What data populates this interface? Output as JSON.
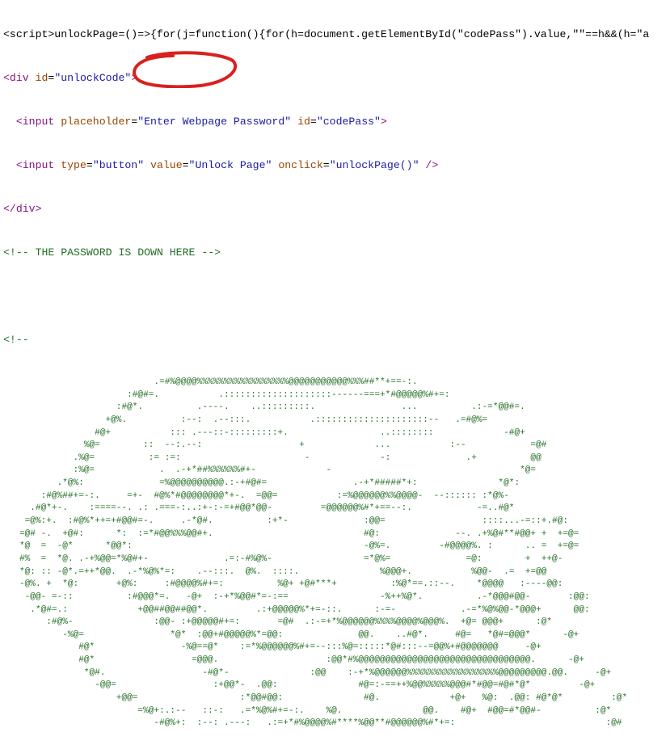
{
  "source": {
    "script_line": "<script>unlockPage=()=>{for(j=function(){for(h=document.getElementById(\"codePass\").value,\"\"==h&&(h=\"a",
    "div_open": {
      "lt": "<",
      "name": "div",
      "attr": "id",
      "eq": "=",
      "value": "\"unlockCode\"",
      "gt": ">"
    },
    "input1": {
      "indent": "  ",
      "open": "<input",
      "attr1": "placeholder",
      "val1": "\"Enter Webpage Password\"",
      "attr2": "id",
      "val2": "\"codePass\"",
      "close": ">"
    },
    "input2": {
      "indent": "  ",
      "open": "<input",
      "attr1": "type",
      "val1": "\"button\"",
      "attr2": "value",
      "val2": "\"Unlock Page\"",
      "attr3": "onclick",
      "val3": "\"unlockPage()\"",
      "close": "/>"
    },
    "div_close": "</div>",
    "password_comment": "<!-- THE PASSWORD IS DOWN HERE -->",
    "art_comment_open": "<!--"
  },
  "ascii_art": [
    "                            .=#%@@@@%%%%%%%%%%%%%%%%%@@@@@@@@@@@%%%##**+==-:.",
    "                       :#@#=.           .::::::::::::::::::::------===+*#@@@@@%#+=:",
    "                     :#@*.          .----.    ..:::::::::.                ...          .:-=*@@#=.",
    "                   +@%.          :--:  .--:::.           .:::::::::::::::::::::--   .=#@%=",
    "                 #@+           ::: .---::-:::::::::+.                 ..::::::::             -#@+",
    "               %@=        ::  --:.--:                  +             ...           :--            =@#",
    "             .%@=          := :=:                       -             -:              .+          @@",
    "             :%@=            .  .-+*##%%%%%%#+-             -                                   *@=",
    "          .*@%:              =%@@@@@@@@@@.:-+#@#=                .-+*#####*+:               *@*:",
    "       :#@%##+=-:.     =+-  #@%*#@@@@@@@@*+-.  =@@=           :=%@@@@@@%%@@@@-  --:::::: :*@%-",
    "     .#@*+-.    :====--. .: .===-:..:+-:-=+#@@*@@-         =@@@@@@%#*+==--:.            -=..#@*",
    "    =@%:+.  :#@%*++=+#@@#=-.     .-*@#.          :+*-              :@@=                  ::::...-=::+.#@:",
    "   =@# -.  +@#:      *:  :=*#@@%%%@@#+.                            #@:              --. .+%@#**#@@+ +  +=@=",
    "   *@  =  -@*      *@@*:                                           -@%=.         -#@@@@%. :      .. =  +=@=",
    "   #%  =  *@. .-+%@@=*%@#+-              .=:-#%@%-                 =*@%=              =@:        +  ++@-",
    "   *@: :: -@*.=++*@@.  .-*%@%*=:    .--:::.  @%.  ::::.               %@@@+.           %@@-  .=  +=@@",
    "   -@%. +  *@:       +@%:     :#@@@@%#+=:          %@+ +@#***+          :%@*==.::--.    *@@@@   :----@@:",
    "    -@@- =-::          :#@@@*=.   -@+  :-+*%@@#*=-:==                 -%++%@*.          .-*@@@#@@-       :@@:",
    "     .*@#=.:             +@@##@@##@@*.         .:+@@@@@%*+=-::.      :-=-            .-=*%@%@@-*@@@+      @@:",
    "        :#@%-               :@@- :+@@@@@#+=:       =@#  .:-=+*%@@@@@@%%%%@@@@%@@@%.  +@= @@@+      :@*",
    "           -%@=                *@*  :@@+#@@@@@%*=@@:              @@.    ..#@*.     #@=   *@#=@@@*      -@+",
    "              #@*                -%@==@*    :=*%@@@@@@%#+=--:::%@=:::::*@#:::--=@@%+#@@@@@@@     -@+",
    "              #@*                  =@@@.                    :@@*#%@@@@@@@@@@@@@@@@@@@@@@@@@@@@@@@@.      -@+",
    "               *@#.                  -#@*-               :@@    :-+*%@@@@@@%%%%%%%%%%%%%%%%%@@@@@@@@@.@@.     -@+",
    "                 -@@=                  :+@@*-  .@@:               #@=:-==++%@@%%%%%@@@#*#@@=#@#*@*         -@+",
    "                     +@@=                   :*@@#@@:               #@.             +@+   %@:  .@@: #@*@*         :@*",
    "                         =%@+:.:--   ::-:   .=*%@%#+=-:.    %@.               @@.    #@+  #@@=#*@@#-          :@*",
    "                            -#@%+:  :--: .---:   .:=+*#%@@@@%#****%@@**#@@@@@@%#*+=:                            :@#"
  ]
}
